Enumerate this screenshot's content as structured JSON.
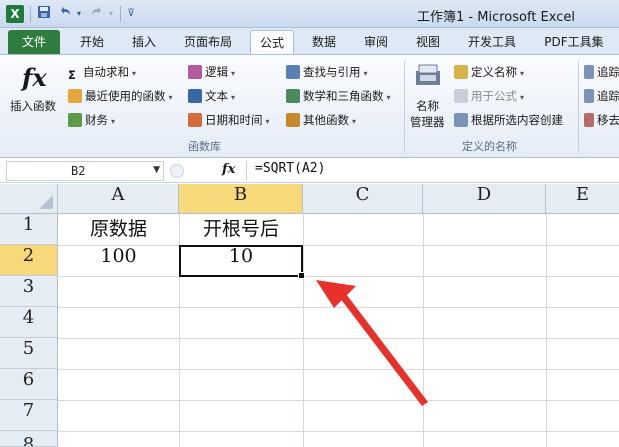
{
  "window": {
    "title": "工作簿1 - Microsoft Excel",
    "app_icon": "X"
  },
  "quick_access": {
    "save_icon": "save-icon",
    "undo_icon": "undo-icon",
    "redo_icon": "redo-icon",
    "customize_icon": "customize-icon"
  },
  "tabs": [
    {
      "label": "文件"
    },
    {
      "label": "开始"
    },
    {
      "label": "插入"
    },
    {
      "label": "页面布局"
    },
    {
      "label": "公式"
    },
    {
      "label": "数据"
    },
    {
      "label": "审阅"
    },
    {
      "label": "视图"
    },
    {
      "label": "开发工具"
    },
    {
      "label": "PDF工具集"
    }
  ],
  "ribbon": {
    "function_library": {
      "insert_function": "插入函数",
      "autosum": "自动求和",
      "recent": "最近使用的函数",
      "financial": "财务",
      "logical": "逻辑",
      "text": "文本",
      "datetime": "日期和时间",
      "lookup": "查找与引用",
      "math": "数学和三角函数",
      "more": "其他函数",
      "group_label": "函数库"
    },
    "defined_names": {
      "name_manager_line1": "名称",
      "name_manager_line2": "管理器",
      "define_name": "定义名称",
      "use_in_formula": "用于公式",
      "create_from_selection": "根据所选内容创建",
      "group_label": "定义的名称"
    },
    "formula_auditing": {
      "trace_precedents": "追踪",
      "trace_dependents": "追踪",
      "remove_arrows": "移去"
    }
  },
  "formula_bar": {
    "name_box": "B2",
    "fx_label": "fx",
    "formula": "=SQRT(A2)"
  },
  "sheet": {
    "columns": [
      "A",
      "B",
      "C",
      "D",
      "E"
    ],
    "rows": [
      "1",
      "2",
      "3",
      "4",
      "5",
      "6",
      "7",
      "8"
    ],
    "selected_cell": "B2",
    "cells": {
      "A1": "原数据",
      "B1": "开根号后",
      "A2": "100",
      "B2": "10"
    }
  },
  "annotation": {
    "arrow_color": "#e8312a"
  },
  "colors": {
    "file_tab": "#2e7d3f",
    "selection_header": "#f8d97a"
  }
}
